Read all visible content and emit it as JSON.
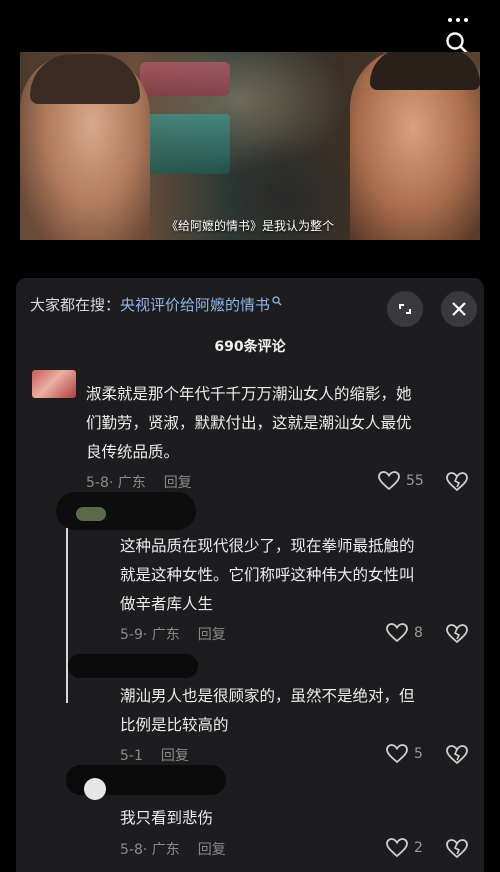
{
  "video": {
    "subtitle": "《给阿嬷的情书》是我认为整个"
  },
  "panel": {
    "search_prefix": "大家都在搜：",
    "search_link": "央视评价给阿嬷的情书",
    "comment_count": "690条评论"
  },
  "comments": [
    {
      "text": "淑柔就是那个年代千千万万潮汕女人的缩影，她们勤劳，贤淑，默默付出，这就是潮汕女人最优良传统品质。",
      "line1": "淑柔就是那个年代千千万万潮汕女人的缩影，她",
      "line2": "们勤劳，贤淑，默默付出，这就是潮汕女人最优",
      "line3": "良传统品质。",
      "meta": "5-8· 广东",
      "reply": "回复",
      "likes": "55"
    },
    {
      "line1": "这种品质在现代很少了，现在拳师最抵触的",
      "line2": "就是这种女性。它们称呼这种伟大的女性叫",
      "line3": "做辛者库人生",
      "meta": "5-9· 广东",
      "reply": "回复",
      "likes": "8"
    },
    {
      "line1": "潮汕男人也是很顾家的，虽然不是绝对，但",
      "line2": "比例是比较高的",
      "meta": "5-1",
      "reply": "回复",
      "likes": "5"
    },
    {
      "line1": "我只看到悲伤",
      "meta": "5-8· 广东",
      "reply": "回复",
      "likes": "2"
    }
  ],
  "colors": {
    "panel_bg": "#1d1d1f",
    "link_blue": "#8fb4e6",
    "muted": "#8a8a8a"
  },
  "icons": {
    "more": "more-dots-icon",
    "search": "search-icon",
    "expand": "expand-icon",
    "close": "close-icon",
    "like": "heart-icon",
    "dislike": "broken-heart-icon"
  }
}
